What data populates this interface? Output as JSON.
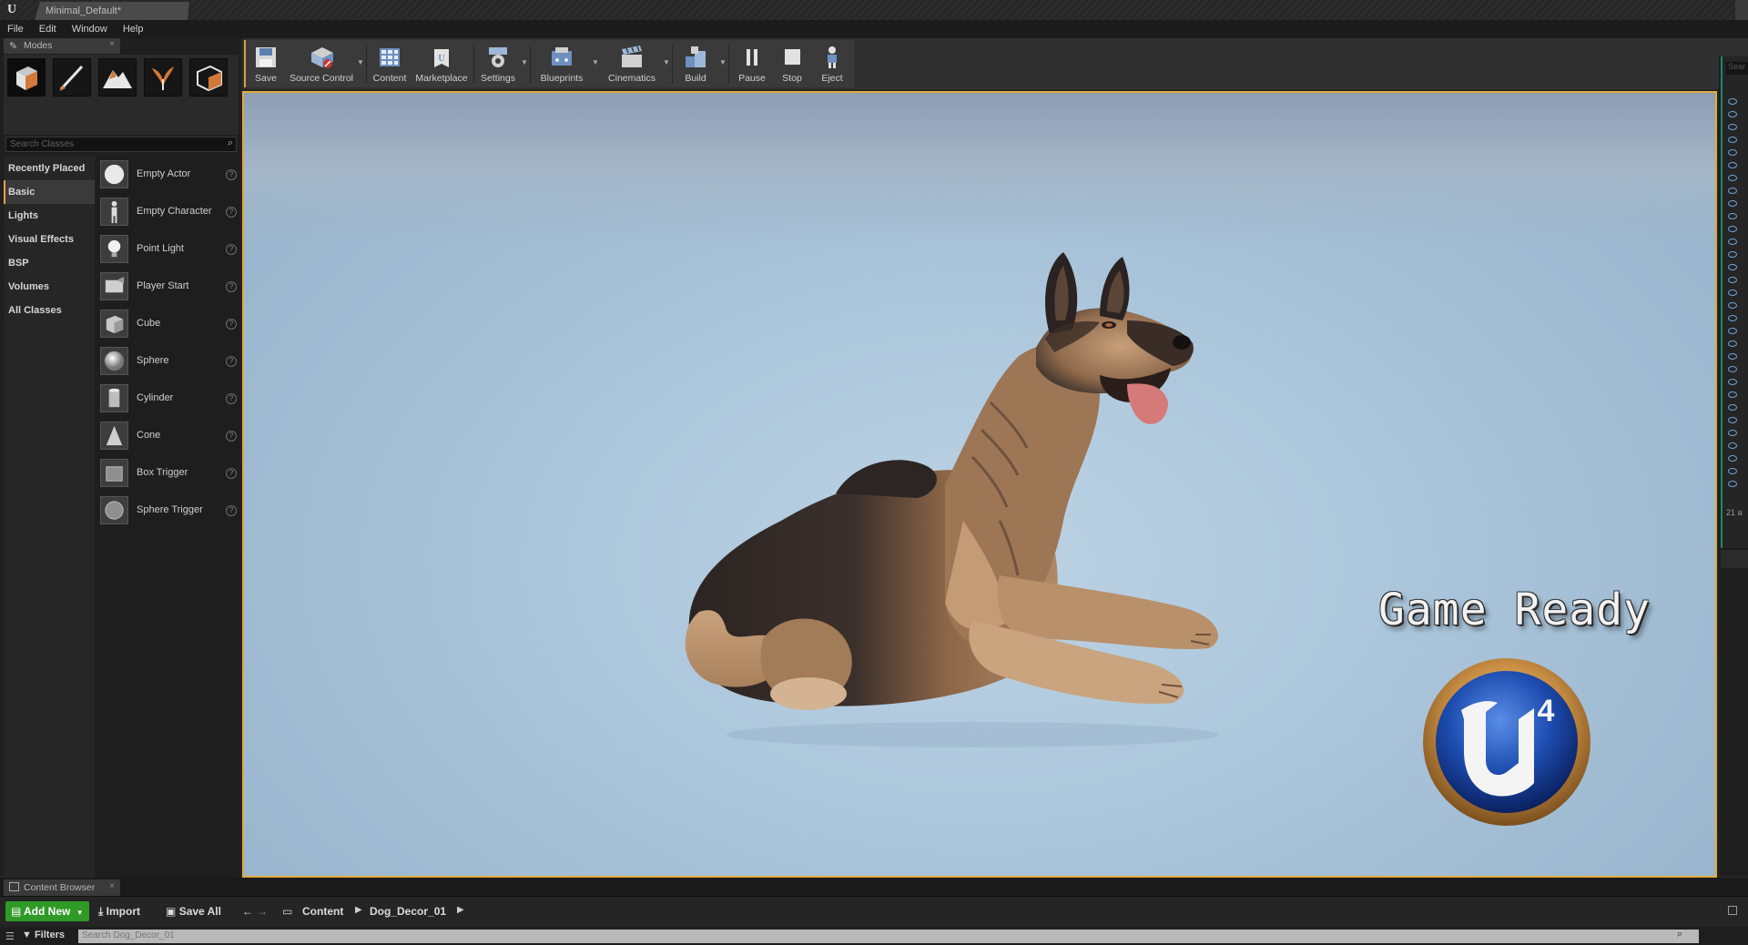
{
  "titlebar": {
    "doc_tab": "Minimal_Default*"
  },
  "menu": [
    "File",
    "Edit",
    "Window",
    "Help"
  ],
  "modes": {
    "tab_label": "Modes",
    "search_placeholder": "Search Classes",
    "categories": [
      {
        "label": "Recently Placed",
        "selected": false
      },
      {
        "label": "Basic",
        "selected": true
      },
      {
        "label": "Lights",
        "selected": false
      },
      {
        "label": "Visual Effects",
        "selected": false
      },
      {
        "label": "BSP",
        "selected": false
      },
      {
        "label": "Volumes",
        "selected": false
      },
      {
        "label": "All Classes",
        "selected": false
      }
    ],
    "items": [
      "Empty Actor",
      "Empty Character",
      "Point Light",
      "Player Start",
      "Cube",
      "Sphere",
      "Cylinder",
      "Cone",
      "Box Trigger",
      "Sphere Trigger"
    ]
  },
  "toolbar": {
    "buttons": [
      "Save",
      "Source Control",
      "Content",
      "Marketplace",
      "Settings",
      "Blueprints",
      "Cinematics",
      "Build",
      "Pause",
      "Stop",
      "Eject"
    ]
  },
  "viewport": {
    "overlay_text": "Game Ready",
    "logo_badge": "4",
    "accent_color": "#e2a93f"
  },
  "outliner": {
    "search_placeholder": "Sear",
    "count_text": "21 a"
  },
  "content_browser": {
    "tab_label": "Content Browser",
    "add_new": "Add New",
    "import": "Import",
    "save_all": "Save All",
    "breadcrumbs": [
      "Content",
      "Dog_Decor_01"
    ],
    "filters": "Filters",
    "search_placeholder": "Search Dog_Decor_01",
    "add_new_color": "#2f9a26"
  }
}
